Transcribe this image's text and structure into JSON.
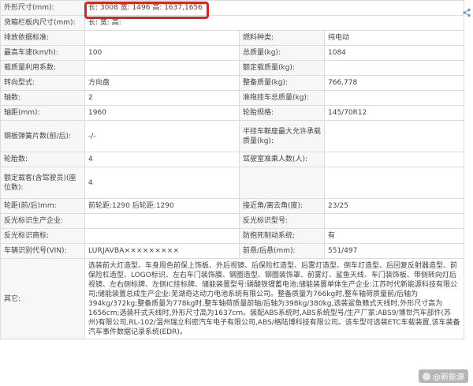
{
  "rows": {
    "r1": {
      "label": "外形尺寸(mm):",
      "value": "长: 3008 宽: 1496 高: 1637,1656"
    },
    "r2": {
      "label": "货箱栏板内尺寸(mm):",
      "value": "长: 宽: 高:"
    },
    "r3": {
      "l1": "排放依据标准:",
      "v1": "",
      "l2": "燃料种类:",
      "v2": "纯电动"
    },
    "r4": {
      "l1": "最高车速(km/h):",
      "v1": "100",
      "l2": "总质量(kg):",
      "v2": "1084"
    },
    "r5": {
      "l1": "载质量利用系数:",
      "v1": "",
      "l2": "额定载质量(kg):",
      "v2": ""
    },
    "r6": {
      "l1": "转向型式:",
      "v1": "方向盘",
      "l2": "整备质量(kg):",
      "v2": "766,778"
    },
    "r7": {
      "l1": "轴数:",
      "v1": "2",
      "l2": "准拖挂车总质量(kg):",
      "v2": ""
    },
    "r8": {
      "l1": "轴距(mm):",
      "v1": "1960",
      "l2": "轮胎规格:",
      "v2": "145/70R12"
    },
    "r9": {
      "l1": "钢板弹簧片数(前/后):",
      "v1": "-/-",
      "l2": "半挂车鞍座最大允许承载质量(kg):",
      "v2": ""
    },
    "r10": {
      "l1": "轮胎数:",
      "v1": "4",
      "l2": "驾驶室准乘人数(人):",
      "v2": ""
    },
    "r11": {
      "l1": "额定载客(含驾驶员)(座位数):",
      "v1": "4",
      "l2": "",
      "v2": ""
    },
    "r12": {
      "l1": "轮距(前/后)mm:",
      "v1": "前轮距:1290 后轮距:1290",
      "l2": "接近角/离去角(度):",
      "v2": "23/25"
    },
    "r13": {
      "l1": "反光标识生产企业:",
      "v1": "",
      "l2": "反光标识型号:",
      "v2": ""
    },
    "r14": {
      "l1": "反光标识商标:",
      "v1": "",
      "l2": "防抱死制动系统:",
      "v2": "有"
    },
    "r15": {
      "l1": "车辆识别代号(VIN):",
      "v1": "LURJAVBA×××××××××",
      "l2": "前悬/后悬(mm):",
      "v2": "551/497"
    },
    "r16": {
      "label": "其它:",
      "value": "选装前大灯造型、车身周色前保上饰板、外后视镜、后保险杠造型、后雾灯造型、倒车灯造型、后回复反射器造型、前保险杠造型、LOGO标识、左右车门装饰膜、钢圈造型、钢圈装饰罩、前雾灯、鲨鱼天线、车门装饰板、带侧转向灯后视镜、左右侧标牌、左侧IC挂标牌、储能装置型号:磷酸铁锂蓄电池;储能装置单体生产企业:江苏时代新能源科技有限公司;储能装置总成生产企业:芜湖奇达动力电池系统有限公司。整备质量为766kg时,整车轴荷质量前/后轴为394kg/372kg;整备质量为778kg时,整车轴荷质量前轴/后轴为398kg/380kg,选装鲨鱼鳍式天线时,外形尺寸高为1656cm;选装杆式天线时,外形尺寸高为1637cm。装配ABS系统时,ABS系统型号/生产厂家:ABS9/博世汽车部件(苏州)有限公司,RL-102/温州瑞立科密汽车电子有限公司,ABS/格陆博科技有限公司。该车型可选装ETC车载装置,该车装备汽车事件数据记录系统(EDR)。"
    }
  },
  "watermark": "@新能源"
}
